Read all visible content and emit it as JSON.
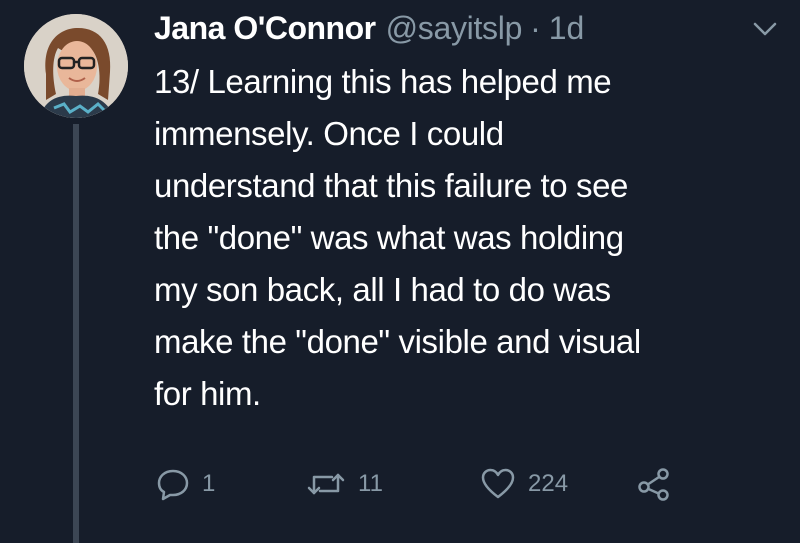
{
  "tweet": {
    "author_name": "Jana O'Connor",
    "handle": "@sayitslp",
    "separator": "·",
    "time": "1d",
    "text_lines": [
      "13/ Learning this has helped me",
      "immensely. Once I could",
      "understand that this failure to see",
      "the \"done\" was what was holding",
      "my son back, all I had to do was",
      "make the \"done\" visible and visual",
      "for him."
    ],
    "actions": {
      "replies": "1",
      "retweets": "11",
      "likes": "224"
    }
  },
  "icons": {
    "menu": "chevron-down-icon",
    "reply": "reply-icon",
    "retweet": "retweet-icon",
    "like": "heart-icon",
    "share": "share-icon"
  },
  "colors": {
    "background": "#161d2a",
    "text": "#ffffff",
    "muted": "#8899a6",
    "thread_line": "#3c4654"
  }
}
